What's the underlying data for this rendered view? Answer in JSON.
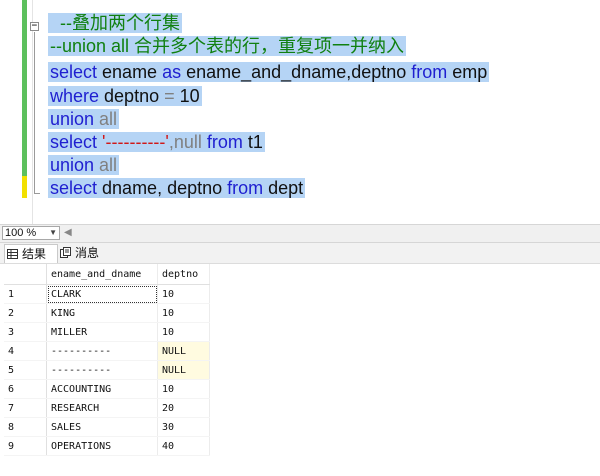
{
  "editor": {
    "lines": [
      [
        {
          "t": "  --叠加两个行集",
          "c": "cm"
        }
      ],
      [
        {
          "t": "--union all 合并多个表的行，重复项一并纳入",
          "c": "cm"
        }
      ],
      [
        {
          "t": "select",
          "c": "kw"
        },
        {
          "t": " ename ",
          "c": "tx"
        },
        {
          "t": "as",
          "c": "kw"
        },
        {
          "t": " ename_and_dname,deptno ",
          "c": "tx"
        },
        {
          "t": "from",
          "c": "kw"
        },
        {
          "t": " emp",
          "c": "tx"
        }
      ],
      [
        {
          "t": "where",
          "c": "kw"
        },
        {
          "t": " deptno ",
          "c": "tx"
        },
        {
          "t": "=",
          "c": "gray"
        },
        {
          "t": " 10",
          "c": "tx"
        }
      ],
      [
        {
          "t": "union",
          "c": "kw"
        },
        {
          "t": " all",
          "c": "gray"
        }
      ],
      [
        {
          "t": "select",
          "c": "kw"
        },
        {
          "t": " ",
          "c": "tx"
        },
        {
          "t": "'----------'",
          "c": "str"
        },
        {
          "t": ",null",
          "c": "gray"
        },
        {
          "t": " from",
          "c": "kw"
        },
        {
          "t": " t1",
          "c": "tx"
        }
      ],
      [
        {
          "t": "union",
          "c": "kw"
        },
        {
          "t": " all",
          "c": "gray"
        }
      ],
      [
        {
          "t": "select",
          "c": "kw"
        },
        {
          "t": " dname, deptno ",
          "c": "tx"
        },
        {
          "t": "from",
          "c": "kw"
        },
        {
          "t": " dept",
          "c": "tx"
        }
      ]
    ]
  },
  "toolbar": {
    "zoom": "100 %"
  },
  "tabs": {
    "results": "结果",
    "messages": "消息"
  },
  "grid": {
    "columns": [
      "ename_and_dname",
      "deptno"
    ],
    "rows": [
      {
        "n": "1",
        "a": "CLARK",
        "b": "10"
      },
      {
        "n": "2",
        "a": "KING",
        "b": "10"
      },
      {
        "n": "3",
        "a": "MILLER",
        "b": "10"
      },
      {
        "n": "4",
        "a": "----------",
        "b": "NULL"
      },
      {
        "n": "5",
        "a": "----------",
        "b": "NULL"
      },
      {
        "n": "6",
        "a": "ACCOUNTING",
        "b": "10"
      },
      {
        "n": "7",
        "a": "RESEARCH",
        "b": "20"
      },
      {
        "n": "8",
        "a": "SALES",
        "b": "30"
      },
      {
        "n": "9",
        "a": "OPERATIONS",
        "b": "40"
      }
    ]
  },
  "colors": {
    "selection": "#b5d4f5",
    "keyword": "#1f1fd0",
    "comment": "#108010",
    "string": "#d01818",
    "null_cell": "#fffbe0",
    "gutter_green": "#5cc05c",
    "gutter_yellow": "#f2e000"
  }
}
